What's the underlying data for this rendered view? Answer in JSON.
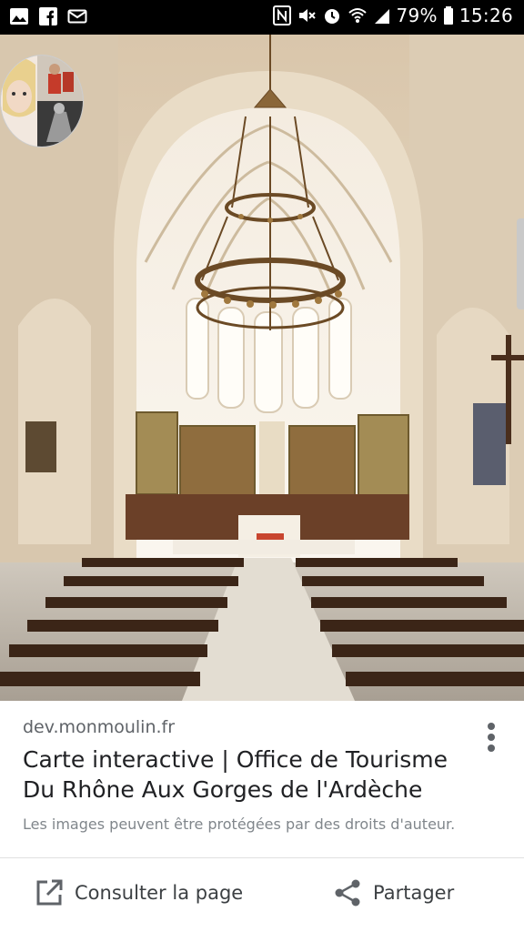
{
  "status_bar": {
    "battery": "79%",
    "time": "15:26",
    "left_icons": [
      "gallery-icon",
      "facebook-icon",
      "mail-icon"
    ],
    "right_icons": [
      "nfc-icon",
      "mute-icon",
      "alarm-icon",
      "wifi-icon",
      "signal-icon",
      "battery-icon"
    ]
  },
  "hero": {
    "subject": "church interior with chandelier and pews",
    "avatar": "profile-avatar"
  },
  "result": {
    "domain": "dev.monmoulin.fr",
    "title": "Carte interactive | Office de Tourisme Du Rhône Aux Gorges de l'Ardèche",
    "rights_notice": "Les images peuvent être protégées par des droits d'auteur."
  },
  "actions": {
    "visit_label": "Consulter la page",
    "share_label": "Partager"
  },
  "colors": {
    "status_bar_bg": "#000000",
    "text_primary": "#202124",
    "text_secondary": "#5f6368",
    "text_muted": "#80868b"
  }
}
